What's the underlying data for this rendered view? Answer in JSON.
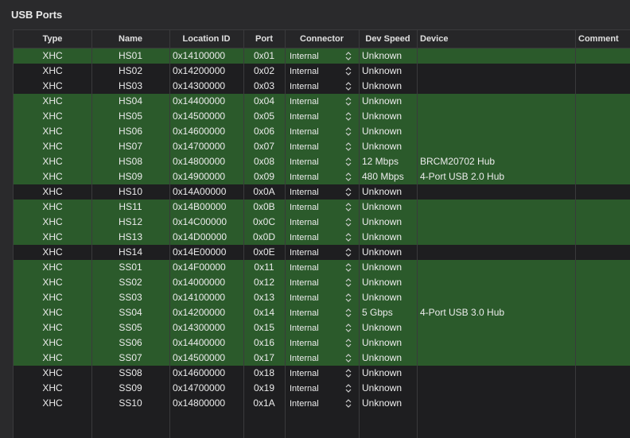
{
  "section_title": "USB Ports",
  "columns": [
    "Type",
    "Name",
    "Location ID",
    "Port",
    "Connector",
    "Dev Speed",
    "Device",
    "Comment"
  ],
  "status_colors": {
    "active_row": "#2b5a2b",
    "inactive_row": "#1e1e20"
  },
  "rows": [
    {
      "type": "XHC",
      "name": "HS01",
      "location": "0x14100000",
      "port": "0x01",
      "connector": "Internal",
      "speed": "Unknown",
      "device": "",
      "comment": "",
      "active": true
    },
    {
      "type": "XHC",
      "name": "HS02",
      "location": "0x14200000",
      "port": "0x02",
      "connector": "Internal",
      "speed": "Unknown",
      "device": "",
      "comment": "",
      "active": false
    },
    {
      "type": "XHC",
      "name": "HS03",
      "location": "0x14300000",
      "port": "0x03",
      "connector": "Internal",
      "speed": "Unknown",
      "device": "",
      "comment": "",
      "active": false
    },
    {
      "type": "XHC",
      "name": "HS04",
      "location": "0x14400000",
      "port": "0x04",
      "connector": "Internal",
      "speed": "Unknown",
      "device": "",
      "comment": "",
      "active": true
    },
    {
      "type": "XHC",
      "name": "HS05",
      "location": "0x14500000",
      "port": "0x05",
      "connector": "Internal",
      "speed": "Unknown",
      "device": "",
      "comment": "",
      "active": true
    },
    {
      "type": "XHC",
      "name": "HS06",
      "location": "0x14600000",
      "port": "0x06",
      "connector": "Internal",
      "speed": "Unknown",
      "device": "",
      "comment": "",
      "active": true
    },
    {
      "type": "XHC",
      "name": "HS07",
      "location": "0x14700000",
      "port": "0x07",
      "connector": "Internal",
      "speed": "Unknown",
      "device": "",
      "comment": "",
      "active": true
    },
    {
      "type": "XHC",
      "name": "HS08",
      "location": "0x14800000",
      "port": "0x08",
      "connector": "Internal",
      "speed": "12 Mbps",
      "device": "BRCM20702 Hub",
      "comment": "",
      "active": true
    },
    {
      "type": "XHC",
      "name": "HS09",
      "location": "0x14900000",
      "port": "0x09",
      "connector": "Internal",
      "speed": "480 Mbps",
      "device": "4-Port USB 2.0 Hub",
      "comment": "",
      "active": true
    },
    {
      "type": "XHC",
      "name": "HS10",
      "location": "0x14A00000",
      "port": "0x0A",
      "connector": "Internal",
      "speed": "Unknown",
      "device": "",
      "comment": "",
      "active": false
    },
    {
      "type": "XHC",
      "name": "HS11",
      "location": "0x14B00000",
      "port": "0x0B",
      "connector": "Internal",
      "speed": "Unknown",
      "device": "",
      "comment": "",
      "active": true
    },
    {
      "type": "XHC",
      "name": "HS12",
      "location": "0x14C00000",
      "port": "0x0C",
      "connector": "Internal",
      "speed": "Unknown",
      "device": "",
      "comment": "",
      "active": true
    },
    {
      "type": "XHC",
      "name": "HS13",
      "location": "0x14D00000",
      "port": "0x0D",
      "connector": "Internal",
      "speed": "Unknown",
      "device": "",
      "comment": "",
      "active": true
    },
    {
      "type": "XHC",
      "name": "HS14",
      "location": "0x14E00000",
      "port": "0x0E",
      "connector": "Internal",
      "speed": "Unknown",
      "device": "",
      "comment": "",
      "active": false
    },
    {
      "type": "XHC",
      "name": "SS01",
      "location": "0x14F00000",
      "port": "0x11",
      "connector": "Internal",
      "speed": "Unknown",
      "device": "",
      "comment": "",
      "active": true
    },
    {
      "type": "XHC",
      "name": "SS02",
      "location": "0x14000000",
      "port": "0x12",
      "connector": "Internal",
      "speed": "Unknown",
      "device": "",
      "comment": "",
      "active": true
    },
    {
      "type": "XHC",
      "name": "SS03",
      "location": "0x14100000",
      "port": "0x13",
      "connector": "Internal",
      "speed": "Unknown",
      "device": "",
      "comment": "",
      "active": true
    },
    {
      "type": "XHC",
      "name": "SS04",
      "location": "0x14200000",
      "port": "0x14",
      "connector": "Internal",
      "speed": "5 Gbps",
      "device": "4-Port USB 3.0 Hub",
      "comment": "",
      "active": true
    },
    {
      "type": "XHC",
      "name": "SS05",
      "location": "0x14300000",
      "port": "0x15",
      "connector": "Internal",
      "speed": "Unknown",
      "device": "",
      "comment": "",
      "active": true
    },
    {
      "type": "XHC",
      "name": "SS06",
      "location": "0x14400000",
      "port": "0x16",
      "connector": "Internal",
      "speed": "Unknown",
      "device": "",
      "comment": "",
      "active": true
    },
    {
      "type": "XHC",
      "name": "SS07",
      "location": "0x14500000",
      "port": "0x17",
      "connector": "Internal",
      "speed": "Unknown",
      "device": "",
      "comment": "",
      "active": true
    },
    {
      "type": "XHC",
      "name": "SS08",
      "location": "0x14600000",
      "port": "0x18",
      "connector": "Internal",
      "speed": "Unknown",
      "device": "",
      "comment": "",
      "active": false
    },
    {
      "type": "XHC",
      "name": "SS09",
      "location": "0x14700000",
      "port": "0x19",
      "connector": "Internal",
      "speed": "Unknown",
      "device": "",
      "comment": "",
      "active": false
    },
    {
      "type": "XHC",
      "name": "SS10",
      "location": "0x14800000",
      "port": "0x1A",
      "connector": "Internal",
      "speed": "Unknown",
      "device": "",
      "comment": "",
      "active": false
    }
  ]
}
